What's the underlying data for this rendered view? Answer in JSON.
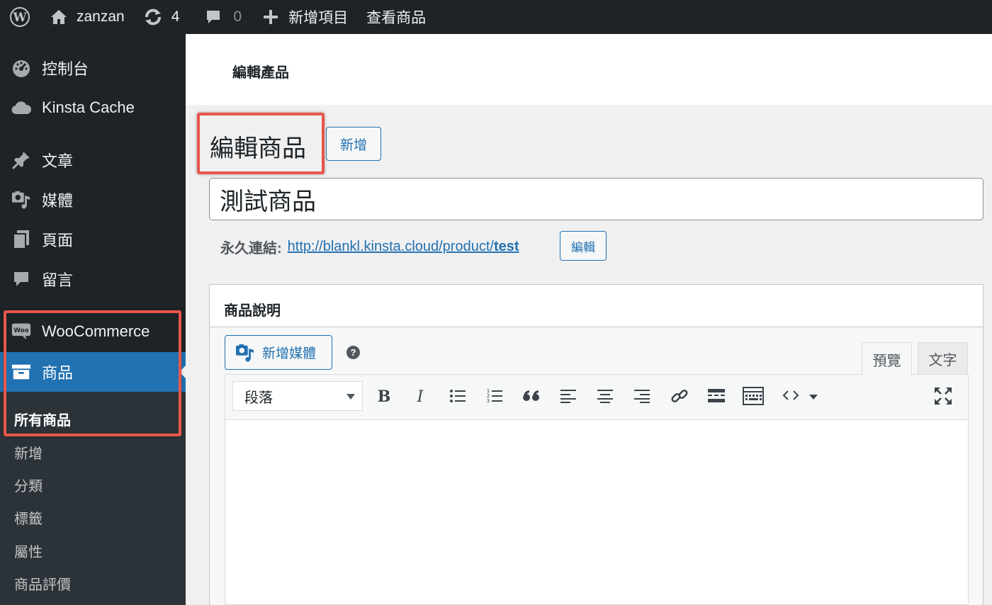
{
  "adminbar": {
    "site_name": "zanzan",
    "updates_count": "4",
    "comments_count": "0",
    "new_label": "新增項目",
    "view_label": "查看商品"
  },
  "sidebar": {
    "items": [
      {
        "label": "控制台",
        "icon": "dashboard-icon"
      },
      {
        "label": "Kinsta Cache",
        "icon": "cloud-icon"
      },
      {
        "label": "文章",
        "icon": "pin-icon"
      },
      {
        "label": "媒體",
        "icon": "media-icon"
      },
      {
        "label": "頁面",
        "icon": "pages-icon"
      },
      {
        "label": "留言",
        "icon": "comment-icon"
      },
      {
        "label": "WooCommerce",
        "icon": "woo-icon"
      },
      {
        "label": "商品",
        "icon": "archive-icon"
      }
    ],
    "submenu": [
      "所有商品",
      "新增",
      "分類",
      "標籤",
      "屬性",
      "商品評價"
    ]
  },
  "header": {
    "title": "編輯產品"
  },
  "page": {
    "title": "編輯商品",
    "add_new_label": "新增",
    "product_title": "測試商品",
    "permalink_label": "永久連結:",
    "permalink_base": "http://blankl.kinsta.cloud/product/",
    "permalink_slug": "test",
    "edit_slug_label": "編輯"
  },
  "description": {
    "title": "商品說明",
    "add_media_label": "新增媒體",
    "help_glyph": "?",
    "tab_visual": "預覽",
    "tab_text": "文字",
    "format_value": "段落"
  },
  "colors": {
    "adminbar_bg": "#1d2327",
    "accent": "#2271b1",
    "highlight": "#e8564b"
  }
}
